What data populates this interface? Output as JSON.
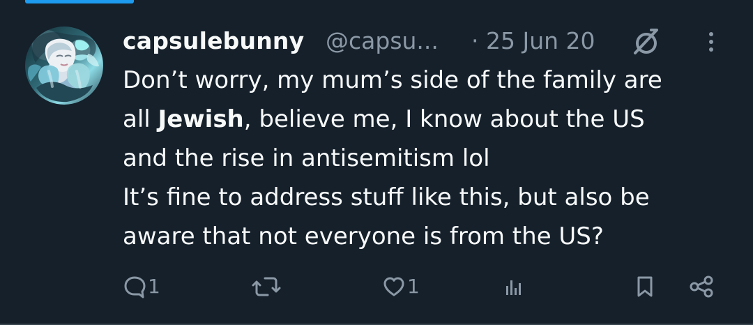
{
  "tweet": {
    "author": {
      "display_name": "capsulebunny",
      "handle": "@capsu..."
    },
    "meta": {
      "separator": "·",
      "date": "25 Jun 20"
    },
    "text": {
      "line1": "Don’t worry, my mum’s side of the family are",
      "line2_prefix": "all ",
      "line2_bold": "Jewish",
      "line2_suffix": ", believe me, I know about the US",
      "line3": "and the rise in antisemitism lol",
      "line4": "It’s fine to address stuff like this, but also be",
      "line5": "aware that not everyone is from the US?"
    },
    "actions": {
      "reply": {
        "icon": "reply-icon",
        "count": "1"
      },
      "repost": {
        "icon": "repost-icon",
        "count": ""
      },
      "like": {
        "icon": "like-icon",
        "count": "1"
      },
      "views": {
        "icon": "views-icon",
        "count": ""
      },
      "bookmark": {
        "icon": "bookmark-icon"
      },
      "share": {
        "icon": "share-icon"
      }
    }
  },
  "colors": {
    "background": "#15202b",
    "text_primary": "#f7f9f9",
    "text_secondary": "#8b98a5",
    "accent": "#1d9bf0",
    "divider": "#38444d"
  }
}
